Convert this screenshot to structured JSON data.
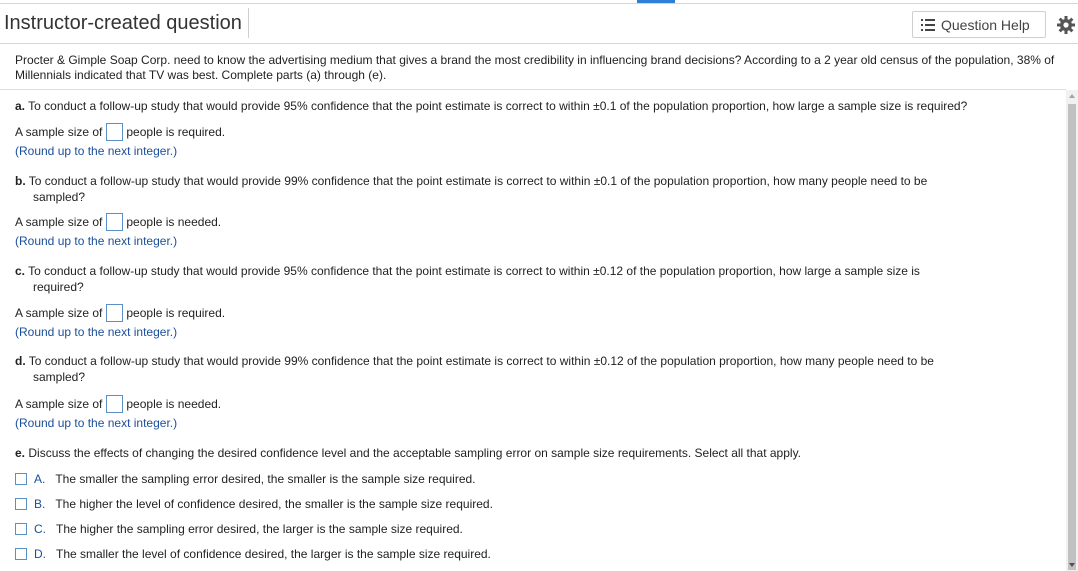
{
  "header": {
    "title": "Instructor-created question",
    "help_label": "Question Help",
    "help_icon": "list-icon",
    "settings_icon": "gear-icon",
    "accent_color": "#2f7fd8"
  },
  "intro": "Procter & Gimple Soap Corp.  need to know the  advertising medium that gives a brand the most credibility in influencing brand decisions? According to a 2 year old census of the population, 38% of Millennials indicated that  TV was best. Complete parts (a) through (e).",
  "parts": [
    {
      "letter": "a.",
      "line1": "To conduct a follow-up study that would provide 95% confidence that the point estimate is correct to within  ±0.1 of the population proportion, how large a sample size is required?",
      "line2": "",
      "answer_prefix": "A sample size of",
      "answer_suffix": "people is required.",
      "answer_value": "",
      "hint": "(Round up to the next integer.)"
    },
    {
      "letter": "b.",
      "line1": "To conduct a follow-up study that would provide 99% confidence that the point estimate is correct to within  ±0.1 of the population proportion, how many people need to be",
      "line2": "sampled?",
      "answer_prefix": "A sample size of",
      "answer_suffix": "people is needed.",
      "answer_value": "",
      "hint": "(Round up to the next integer.)"
    },
    {
      "letter": "c.",
      "line1": "To conduct a follow-up study that would provide 95% confidence that the point estimate is correct to within  ±0.12 of the population proportion, how large a sample size is",
      "line2": "required?",
      "answer_prefix": "A sample size of",
      "answer_suffix": "people is required.",
      "answer_value": "",
      "hint": "(Round up to the next integer.)"
    },
    {
      "letter": "d.",
      "line1": "To conduct a follow-up study that would provide 99% confidence that the point estimate is correct to within  ±0.12 of the population proportion, how many people need to be",
      "line2": "sampled?",
      "answer_prefix": "A sample size of",
      "answer_suffix": "people is needed.",
      "answer_value": "",
      "hint": "(Round up to the next integer.)"
    }
  ],
  "part_e": {
    "letter": "e.",
    "question": "Discuss the effects of changing the desired confidence level and the acceptable sampling error on sample size requirements. Select all that apply.",
    "options": [
      {
        "letter": "A.",
        "text": "The smaller the sampling error desired, the smaller is the sample size required.",
        "checked": false
      },
      {
        "letter": "B.",
        "text": "The higher the level of confidence desired, the smaller is the sample size required.",
        "checked": false
      },
      {
        "letter": "C.",
        "text": "The higher the sampling error desired, the larger is the sample size required.",
        "checked": false
      },
      {
        "letter": "D.",
        "text": "The smaller the level of confidence desired, the larger is the sample size required.",
        "checked": false
      }
    ]
  }
}
